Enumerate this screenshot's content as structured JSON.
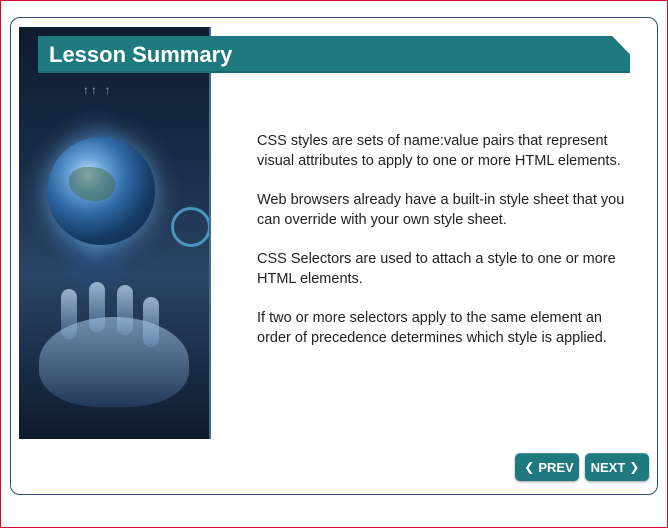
{
  "title": "Lesson Summary",
  "paragraphs": [
    "CSS styles are sets of name:value pairs that represent visual attributes to apply to one or more HTML elements.",
    "Web browsers already have a built-in style sheet that you can override with your own style sheet.",
    "CSS Selectors are used to attach a style to one or more HTML elements.",
    "If two or more selectors apply to the same element an order of precedence determines which style is applied."
  ],
  "nav": {
    "prev_label": "PREV",
    "prev_icon": "chevron-left-icon",
    "next_label": "NEXT",
    "next_icon": "chevron-right-icon"
  },
  "colors": {
    "accent": "#1f7a80",
    "card_border": "#2f4f7a",
    "frame_border": "#c8102e"
  },
  "image": {
    "subject": "globe-in-hand-illustration"
  }
}
